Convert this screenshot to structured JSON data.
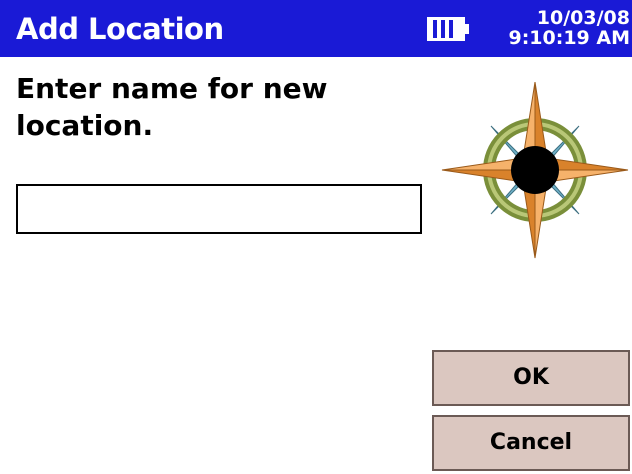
{
  "titlebar": {
    "title": "Add Location",
    "battery_icon": "battery-icon",
    "date": "10/03/08",
    "time": "9:10:19 AM",
    "color": "#1a1ad6"
  },
  "dialog": {
    "prompt": "Enter name for new location.",
    "name_input": {
      "value": "",
      "placeholder": ""
    },
    "compass_icon": "compass-rose-icon",
    "ok_label": "OK",
    "cancel_label": "Cancel",
    "button_color": "#dbc7c0"
  }
}
